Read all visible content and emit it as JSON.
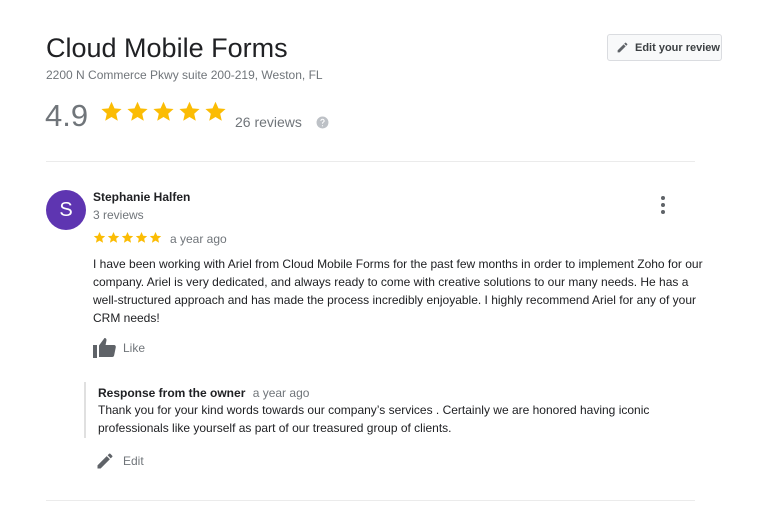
{
  "business": {
    "name": "Cloud Mobile Forms",
    "address": "2200 N Commerce Pkwy suite 200-219, Weston, FL",
    "rating": "4.9",
    "rating_stars": 5,
    "review_count": "26 reviews",
    "edit_review_label": "Edit your review"
  },
  "review": {
    "avatar_letter": "S",
    "avatar_color": "#5e35b1",
    "author": "Stephanie Halfen",
    "author_reviews": "3 reviews",
    "stars": 5,
    "time": "a year ago",
    "text": "I have been working with Ariel from Cloud Mobile Forms for the past few months in order to implement Zoho for our company. Ariel is very dedicated, and always ready to come with creative solutions to our many needs. He has a well-structured approach and has made the process incredibly enjoyable. I highly recommend Ariel for any of your CRM needs!",
    "like_label": "Like",
    "owner_response": {
      "label": "Response from the owner",
      "time": "a year ago",
      "text": "Thank you for your kind words towards our company’s services . Certainly we are honored having iconic professionals like yourself as part of our treasured group of clients."
    },
    "edit_label": "Edit"
  },
  "colors": {
    "star": "#fbbc04",
    "icon": "#70757a"
  },
  "icons": {
    "edit": "pencil-icon",
    "help": "help-icon",
    "more": "more-vert-icon",
    "like": "thumb-up-icon",
    "star": "star-icon"
  }
}
